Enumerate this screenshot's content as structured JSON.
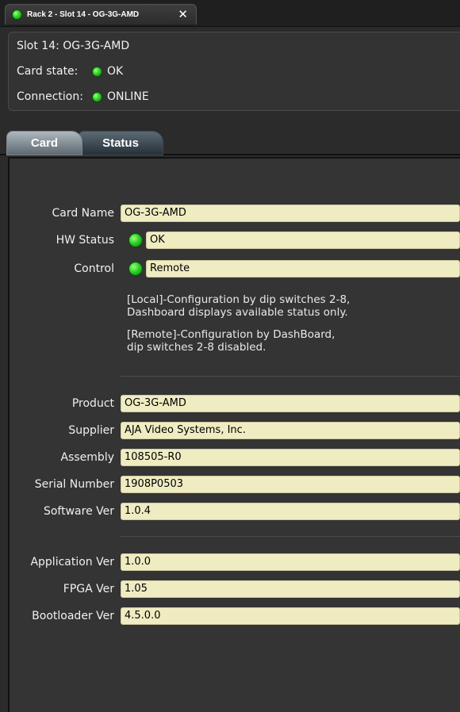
{
  "window": {
    "tab_title": "Rack 2 - Slot 14 - OG-3G-AMD",
    "close_symbol": "✕"
  },
  "info": {
    "slot": "Slot 14: OG-3G-AMD",
    "card_state_label": "Card state:",
    "card_state_value": "OK",
    "connection_label": "Connection:",
    "connection_value": "ONLINE"
  },
  "tabs": [
    {
      "label": "Card",
      "selected": true
    },
    {
      "label": "Status",
      "selected": false
    }
  ],
  "card": {
    "card_name_label": "Card Name",
    "card_name_value": "OG-3G-AMD",
    "hw_status_label": "HW Status",
    "hw_status_value": "OK",
    "control_label": "Control",
    "control_value": "Remote",
    "note_local": "[Local]-Configuration by dip switches 2-8,\nDashboard displays available status only.",
    "note_remote": "[Remote]-Configuration by DashBoard,\ndip switches 2-8 disabled.",
    "product_label": "Product",
    "product_value": "OG-3G-AMD",
    "supplier_label": "Supplier",
    "supplier_value": "AJA Video Systems, Inc.",
    "assembly_label": "Assembly",
    "assembly_value": "108505-R0",
    "serial_label": "Serial Number",
    "serial_value": "1908P0503",
    "software_label": "Software Ver",
    "software_value": "1.0.4",
    "application_label": "Application Ver",
    "application_value": "1.0.0",
    "fpga_label": "FPGA Ver",
    "fpga_value": "1.05",
    "bootloader_label": "Bootloader Ver",
    "bootloader_value": "4.5.0.0"
  },
  "colors": {
    "led_green": "#2ed12a",
    "field_bg": "#efecc2",
    "panel_bg": "#343434"
  }
}
